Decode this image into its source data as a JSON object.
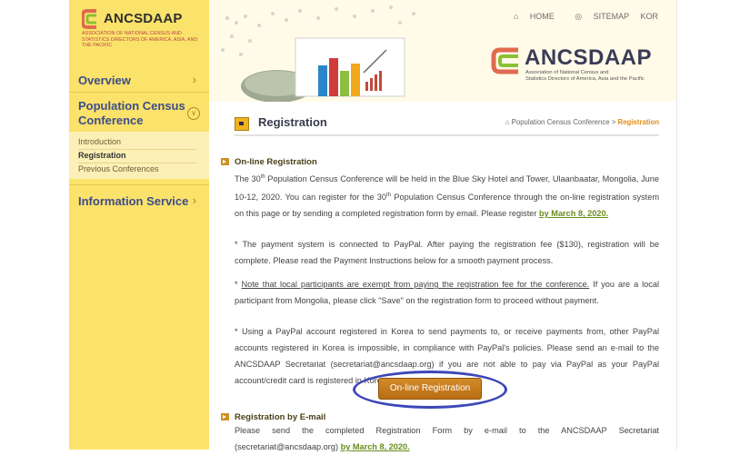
{
  "logo": {
    "name": "ANCSDAAP",
    "tagline": "ASSOCIATION OF NATIONAL CENSUS AND STATISTICS DIRECTORS OF AMERICA, ASIA, AND THE PACIFIC"
  },
  "top_nav": {
    "home": "HOME",
    "sitemap": "SITEMAP",
    "lang": "KOR"
  },
  "banner": {
    "name": "ANCSDAAP",
    "tagline_line1": "Association of National Census and",
    "tagline_line2": "Statistics Directors of America, Asia and the Pacific"
  },
  "sidebar": {
    "overview": "Overview",
    "population_census_line1": "Population Census",
    "population_census_line2": "Conference",
    "sub_items": [
      "Introduction",
      "Registration",
      "Previous Conferences"
    ],
    "info_service": "Information Service"
  },
  "page": {
    "title": "Registration",
    "breadcrumb_parent": "Population Census Conference",
    "breadcrumb_sep": ">",
    "breadcrumb_current": "Registration"
  },
  "online": {
    "title": "On-line Registration",
    "p1_a": "The 30",
    "p1_b": " Population Census Conference will be held in the Blue Sky Hotel and Tower, Ulaanbaatar, Mongolia, June 10-12, 2020. You can register for the 30",
    "p1_c": " Population Census Conference through the on-line registration system on this page or by sending a completed registration form by email. Please register ",
    "p1_deadline": "by March 8, 2020.",
    "sup": "th",
    "p2": "* The payment system is connected to PayPal. After paying the registration fee ($130), registration will be complete. Please read the Payment Instructions below for a smooth payment process.",
    "p3_a": "* ",
    "p3_underlined": "Note that local participants are exempt from paying the registration fee for the conference.",
    "p3_b": " If you are a local participant from Mongolia, please click \"Save\" on the registration form to proceed without payment.",
    "p4": "* Using a PayPal account registered in Korea to send payments to, or receive payments from, other PayPal accounts registered in Korea is impossible, in compliance with PayPal's policies. Please send an e-mail to the ANCSDAAP Secretariat (secretariat@ancsdaap.org) if you are not able to pay via PayPal as your PayPal account/credit card is registered in Korea.",
    "button": "On-line Registration"
  },
  "email": {
    "title": "Registration by E-mail",
    "p_a": "Please send the completed Registration Form by e-mail to the ANCSDAAP Secretariat (secretariat@ancsdaap.org) ",
    "p_deadline": "by March 8, 2020."
  },
  "colors": {
    "sidebar": "#fbe26a",
    "accent": "#e28d16",
    "link": "#6a8d1d",
    "highlight": "#3d47b9"
  }
}
